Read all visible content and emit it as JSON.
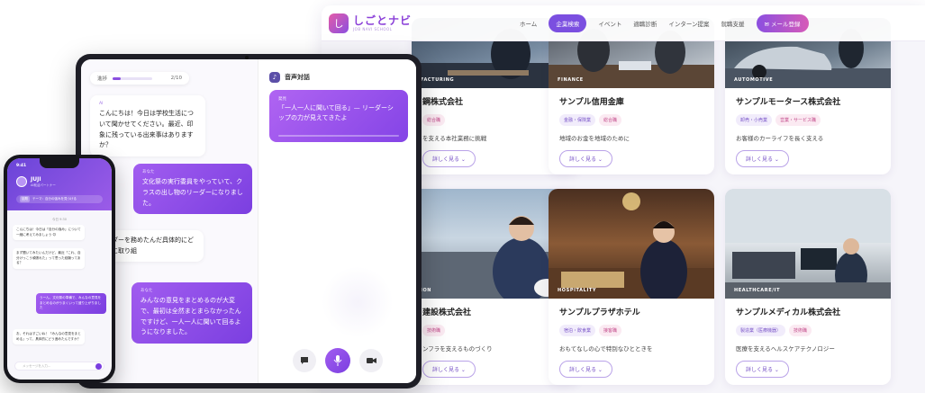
{
  "site": {
    "logo_mark": "し",
    "logo_main": "しごとナビ",
    "logo_sub": "JOB NAVI SCHOOL",
    "nav": [
      "ホーム",
      "企業検索",
      "イベント",
      "適職診断",
      "インターン提案",
      "就職支援"
    ],
    "nav_active_index": 1,
    "mail_button": "✉ メール登録",
    "detail_button": "詳しく見る ⌄",
    "companies": [
      {
        "name": "鋼株式会社",
        "tag": "FACTURING",
        "chips": [
          "総合職"
        ],
        "desc": "を支える本社業務に挑戦"
      },
      {
        "name": "サンプル信用金庫",
        "tag": "FINANCE",
        "chips": [
          "金融・保険業",
          "総合職"
        ],
        "desc": "地域のお金を地域のために"
      },
      {
        "name": "サンプルモータース株式会社",
        "tag": "AUTOMOTIVE",
        "chips": [
          "卸売・小売業",
          "営業・サービス職"
        ],
        "desc": "お客様のカーライフを長く支える"
      },
      {
        "name": "建設株式会社",
        "tag": "ION",
        "chips": [
          "技術職"
        ],
        "desc": "ンフラを支えるものづくり"
      },
      {
        "name": "サンプルプラザホテル",
        "tag": "HOSPITALITY",
        "chips": [
          "宿泊・飲食業",
          "接客職"
        ],
        "desc": "おもてなしの心で特別なひとときを"
      },
      {
        "name": "サンプルメディカル株式会社",
        "tag": "HEALTHCARE/IT",
        "chips": [
          "製造業（医療機器）",
          "技術職"
        ],
        "desc": "医療を支えるヘルスケアテクノロジー"
      }
    ]
  },
  "tablet": {
    "progress_label": "進捗",
    "progress_count": "2/10",
    "progress_fraction": 0.2,
    "ai_tag": "AI",
    "user_tag": "あなた",
    "msg_ai_1": "こんにちは！今日は学校生活について聞かせてください。最近、印象に残っている出来事はありますか？",
    "msg_user_1": "文化祭の実行委員をやっていて、クラスの出し物のリーダーになりました。",
    "msg_ai_2": "祭のリーダーを務めたんだ具体的にどんなことに取り組",
    "msg_user_2": "みんなの意見をまとめるのが大変で、最初は全然まとまらなかったんですけど、一人一人に聞いて回るようになりました。",
    "voice_title": "音声対話",
    "hint_tag": "発見",
    "hint_text": "「一人一人に聞いて回る」— リーダーシップの力が見えてきたよ"
  },
  "phone": {
    "time": "9:41",
    "name": "JUJI",
    "sub": "AI就活パートナー",
    "topic_badge": "話題",
    "topic_text": "テーマ：自分の強みを見つける",
    "date": "今日 9:30",
    "msg1": "こんにちは！今日は「自分の強み」について一緒に考えてみましょう 😊",
    "msg2": "まず聞いてみたいんだけど、最近「これ、自分けっこう頑張れた」って思った経験ってある？",
    "msg3": "うーん、文化祭の準備で、みんなの意見をまとめるのがうまくいって盛り上がりました",
    "msg4": "お、それはすごいね！「みんなの意見をまとめる」って、具体的にどう進めたんですか？",
    "input_placeholder": "メッセージを入力..."
  }
}
